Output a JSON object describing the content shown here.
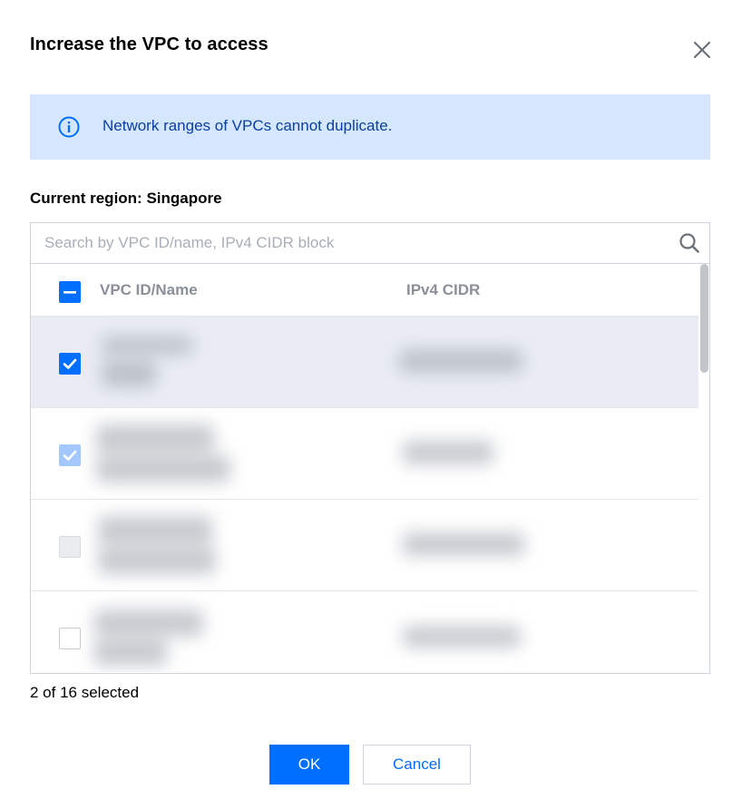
{
  "dialog": {
    "title": "Increase the VPC to access",
    "close_icon": "close-icon"
  },
  "alert": {
    "icon": "info-icon",
    "message": "Network ranges of VPCs cannot duplicate."
  },
  "region_label": "Current region: Singapore",
  "search": {
    "placeholder": "Search by VPC ID/name, IPv4 CIDR block",
    "value": "",
    "icon": "search-icon"
  },
  "table": {
    "select_all_state": "indeterminate",
    "columns": [
      "VPC ID/Name",
      "IPv4 CIDR"
    ],
    "rows": [
      {
        "state": "checked",
        "highlighted": true
      },
      {
        "state": "checked-disabled",
        "highlighted": false
      },
      {
        "state": "disabled",
        "highlighted": false
      },
      {
        "state": "unchecked",
        "highlighted": false
      }
    ]
  },
  "selection_summary": "2 of 16 selected",
  "footer": {
    "ok_label": "OK",
    "cancel_label": "Cancel"
  },
  "colors": {
    "primary": "#006eff",
    "alert_background": "#d5e7ff",
    "alert_text": "#0a3fa0",
    "selected_row": "#e9edf3"
  }
}
